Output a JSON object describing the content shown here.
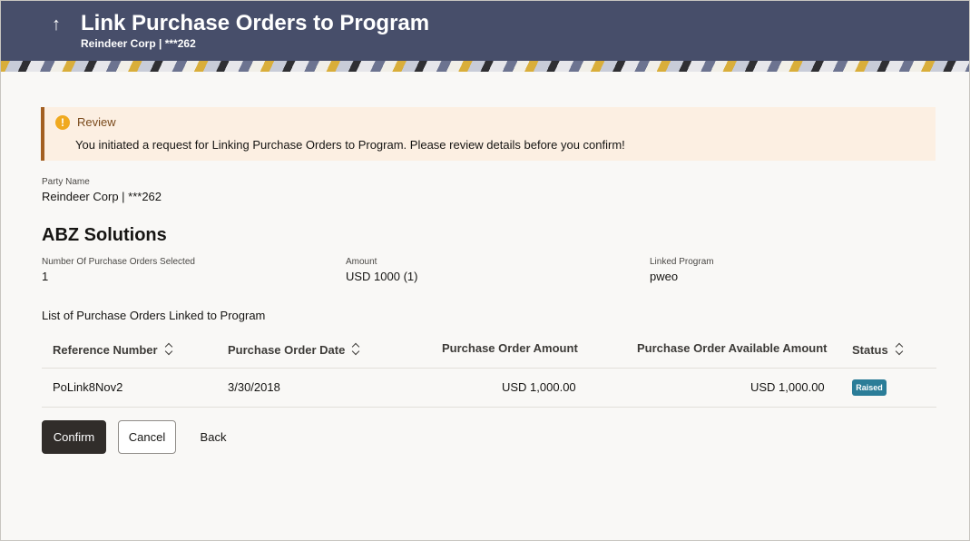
{
  "header": {
    "title": "Link Purchase Orders to Program",
    "subtitle": "Reindeer Corp | ***262",
    "back_icon": "↑"
  },
  "alert": {
    "icon": "!",
    "title": "Review",
    "message": "You initiated a request for Linking Purchase Orders to Program. Please review details before you confirm!",
    "color": "#fcefe2",
    "accent": "#a35f21"
  },
  "party": {
    "label": "Party Name",
    "value": "Reindeer Corp | ***262"
  },
  "section": {
    "title": "ABZ Solutions",
    "fields": [
      {
        "label": "Number Of Purchase Orders Selected",
        "value": "1"
      },
      {
        "label": "Amount",
        "value": "USD 1000 (1)"
      },
      {
        "label": "Linked Program",
        "value": "pweo"
      }
    ]
  },
  "table": {
    "title": "List of Purchase Orders Linked to Program",
    "columns": [
      {
        "label": "Reference Number",
        "sortable": true
      },
      {
        "label": "Purchase Order Date",
        "sortable": true
      },
      {
        "label": "Purchase Order Amount",
        "sortable": false
      },
      {
        "label": "Purchase Order Available Amount",
        "sortable": false
      },
      {
        "label": "Status",
        "sortable": true
      }
    ],
    "rows": [
      {
        "reference": "PoLink8Nov2",
        "date": "3/30/2018",
        "amount": "USD 1,000.00",
        "available": "USD 1,000.00",
        "status": "Raised"
      }
    ]
  },
  "actions": {
    "confirm": "Confirm",
    "cancel": "Cancel",
    "back": "Back"
  },
  "colors": {
    "header_bg": "#474e6a",
    "status_badge": "#2b7d98",
    "primary_button": "#312d2a"
  }
}
